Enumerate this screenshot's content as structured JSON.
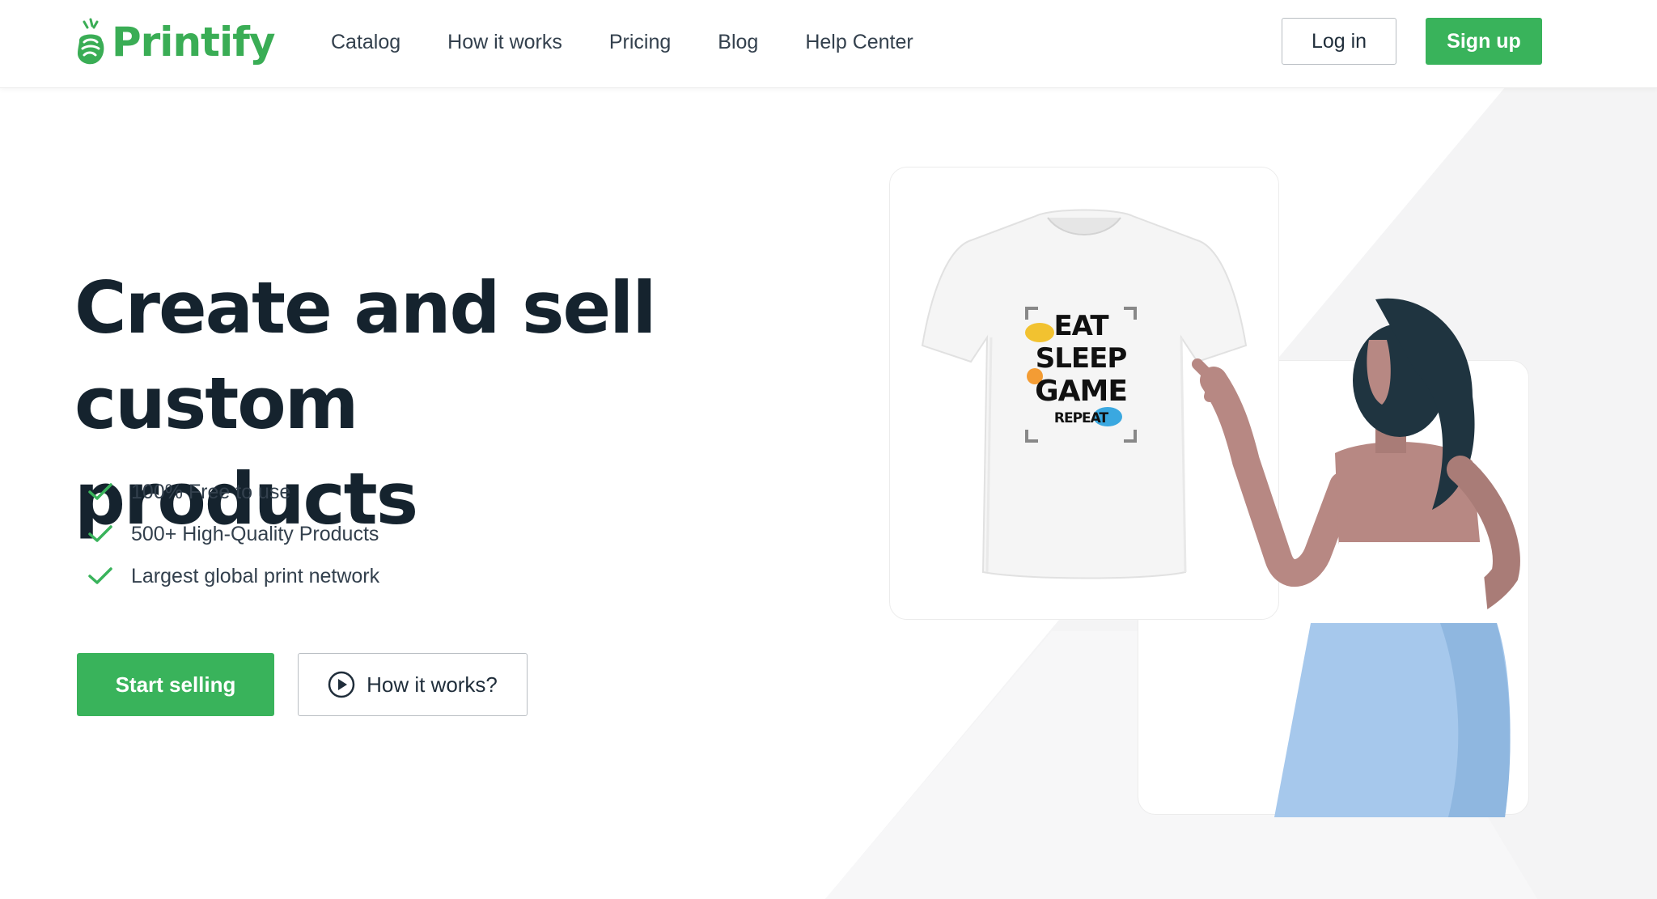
{
  "brand": {
    "name": "Printify",
    "color": "#39b35b"
  },
  "nav": {
    "items": [
      {
        "label": "Catalog"
      },
      {
        "label": "How it works"
      },
      {
        "label": "Pricing"
      },
      {
        "label": "Blog"
      },
      {
        "label": "Help Center"
      }
    ]
  },
  "auth": {
    "login_label": "Log in",
    "signup_label": "Sign up"
  },
  "hero": {
    "title_line1": "Create and sell",
    "title_line2": "custom products",
    "features": [
      {
        "text": "100% Free to use"
      },
      {
        "text": "500+ High-Quality Products"
      },
      {
        "text": "Largest global print network"
      }
    ],
    "primary_cta": "Start selling",
    "secondary_cta": "How it works?"
  },
  "illustration": {
    "shirt_print": [
      "EAT",
      "SLEEP",
      "GAME",
      "REPEAT"
    ]
  }
}
